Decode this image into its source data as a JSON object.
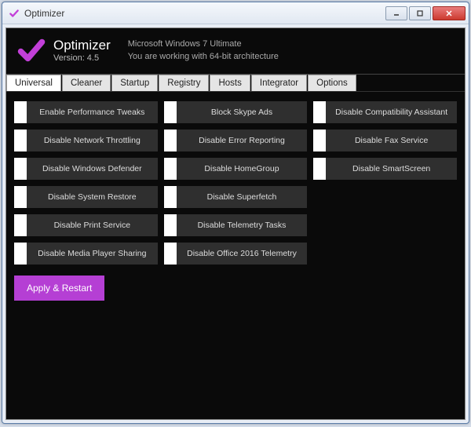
{
  "window": {
    "title": "Optimizer"
  },
  "header": {
    "app_name": "Optimizer",
    "version_label": "Version: 4.5",
    "os_line": "Microsoft Windows 7 Ultimate",
    "arch_line": "You are working with 64-bit architecture"
  },
  "tabs": [
    "Universal",
    "Cleaner",
    "Startup",
    "Registry",
    "Hosts",
    "Integrator",
    "Options"
  ],
  "active_tab": 0,
  "options_col1": [
    "Enable Performance Tweaks",
    "Disable Network Throttling",
    "Disable Windows Defender",
    "Disable System Restore",
    "Disable Print Service",
    "Disable Media Player Sharing"
  ],
  "options_col2": [
    "Block Skype Ads",
    "Disable Error Reporting",
    "Disable HomeGroup",
    "Disable Superfetch",
    "Disable Telemetry Tasks",
    "Disable Office 2016 Telemetry"
  ],
  "options_col3": [
    "Disable Compatibility Assistant",
    "Disable Fax Service",
    "Disable SmartScreen"
  ],
  "apply_label": "Apply & Restart",
  "colors": {
    "accent": "#c23fd8",
    "apply_bg": "#b53fd4"
  }
}
